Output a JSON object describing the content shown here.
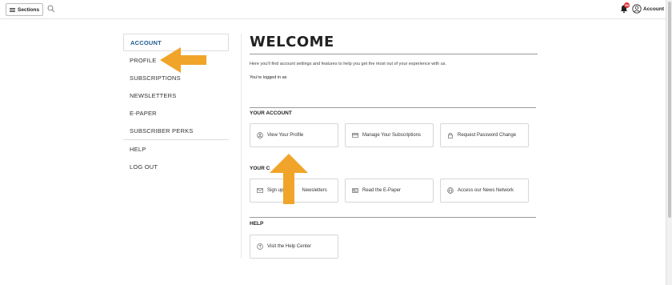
{
  "topbar": {
    "sections_label": "Sections",
    "notification_count": "99",
    "account_label": "Account"
  },
  "sidebar": {
    "items": [
      {
        "label": "ACCOUNT"
      },
      {
        "label": "PROFILE"
      },
      {
        "label": "SUBSCRIPTIONS"
      },
      {
        "label": "NEWSLETTERS"
      },
      {
        "label": "E-PAPER"
      },
      {
        "label": "SUBSCRIBER PERKS"
      },
      {
        "label": "HELP"
      },
      {
        "label": "LOG OUT"
      }
    ]
  },
  "main": {
    "title": "WELCOME",
    "intro": "Here you'll find account settings and features to help you get the most out of your experience with us.",
    "logged_in": "You're logged in as",
    "your_account": {
      "title": "YOUR ACCOUNT",
      "cards": [
        {
          "label": "View Your Profile",
          "icon": "user-circle-icon"
        },
        {
          "label": "Manage Your Subscriptions",
          "icon": "credit-card-icon"
        },
        {
          "label": "Request Password Change",
          "icon": "lock-icon"
        }
      ]
    },
    "your_content": {
      "title": "YOUR C",
      "cards": [
        {
          "label": "Sign up",
          "label_tail": "Newsletters",
          "icon": "mail-icon"
        },
        {
          "label": "Read the E-Paper",
          "icon": "newspaper-icon"
        },
        {
          "label": "Access our News Network",
          "icon": "globe-icon"
        }
      ]
    },
    "help": {
      "title": "HELP",
      "cards": [
        {
          "label": "Visit the Help Center",
          "icon": "question-circle-icon"
        }
      ]
    }
  },
  "colors": {
    "accent": "#1f5c91",
    "arrow": "#f0a52a"
  }
}
